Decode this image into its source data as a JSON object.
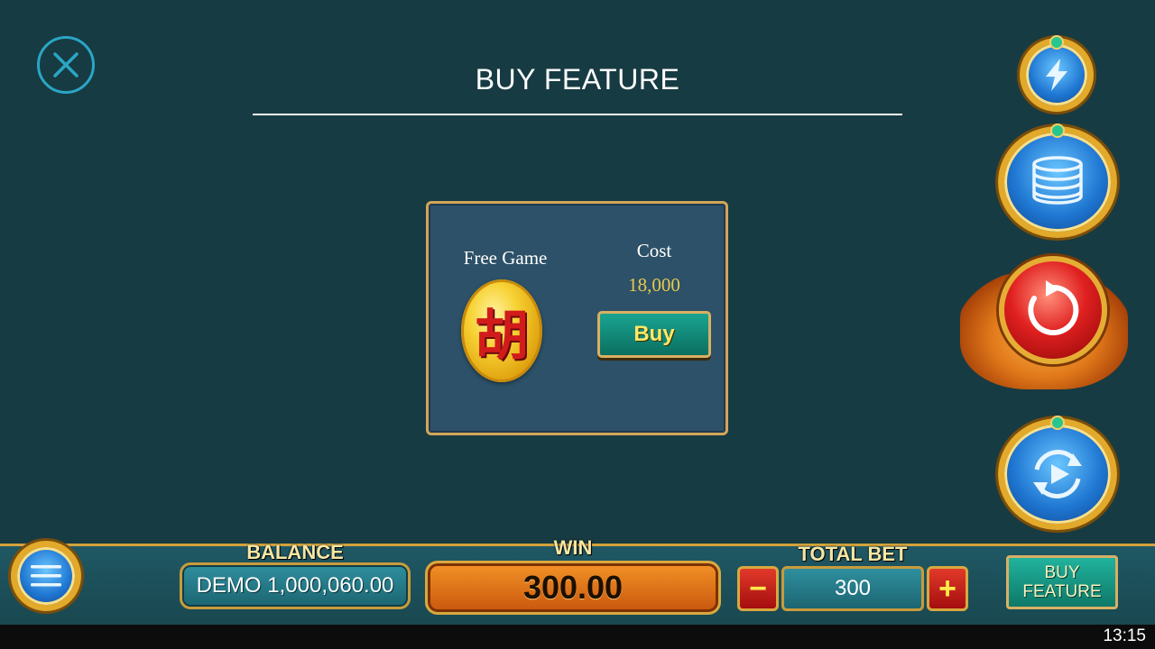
{
  "header": {
    "title": "BUY FEATURE"
  },
  "feature_card": {
    "name": "Free Game",
    "symbol_char": "胡",
    "cost_label": "Cost",
    "cost_value": "18,000",
    "buy_label": "Buy"
  },
  "side_controls": {
    "turbo_icon": "lightning-icon",
    "bet_icon": "coin-stack-icon",
    "spin_icon": "spin-arrow-icon",
    "autoplay_icon": "autoplay-icon"
  },
  "bottom_bar": {
    "balance_label": "BALANCE",
    "balance_value": "DEMO 1,000,060.00",
    "win_label": "WIN",
    "win_value": "300.00",
    "total_bet_label": "TOTAL BET",
    "total_bet_value": "300",
    "decrease_label": "−",
    "increase_label": "+",
    "buy_feature_line1": "BUY",
    "buy_feature_line2": "FEATURE"
  },
  "status_bar": {
    "time": "13:15"
  },
  "colors": {
    "background": "#173b42",
    "accent_gold": "#d3a55a",
    "cost_gold": "#e9c84d",
    "win_orange": "#f39327"
  }
}
